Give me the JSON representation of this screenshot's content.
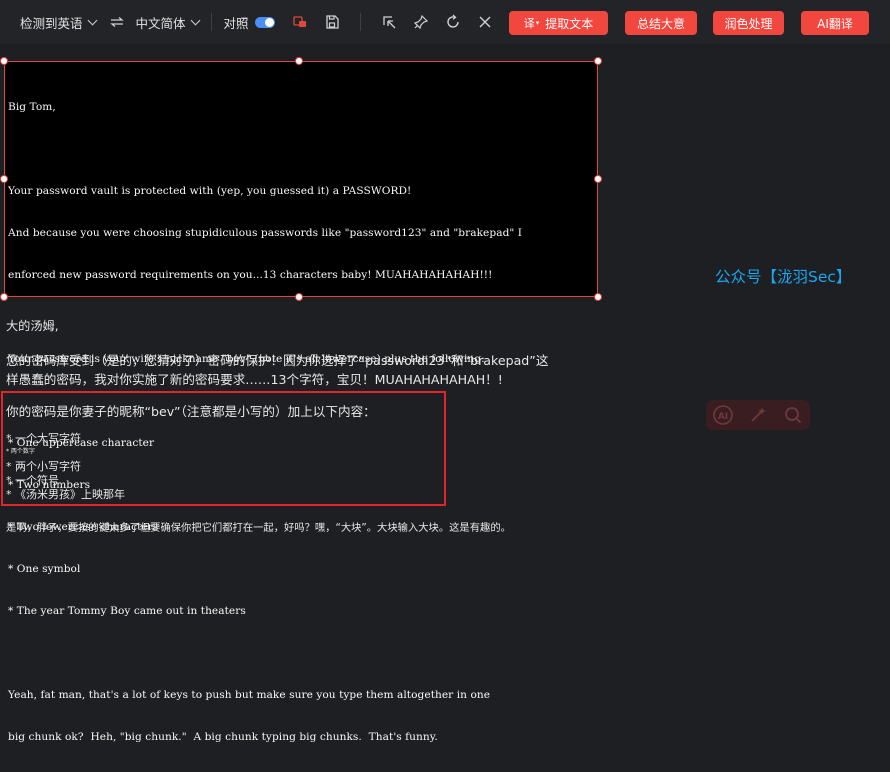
{
  "toolbar": {
    "source_lang": "检测到英语",
    "target_lang": "中文简体",
    "compare_label": "对照",
    "compare_on": true,
    "buttons": {
      "extract_text": "提取文本",
      "extract_badge": "译",
      "summarize": "总结大意",
      "polish": "润色处理",
      "ai_translate": "AI翻译"
    },
    "accent_color": "#f2473f",
    "toggle_color": "#4a8ff7"
  },
  "source": {
    "lines": [
      "Big Tom,",
      "",
      "Your password vault is protected with (yep, you guessed it) a PASSWORD!",
      "And because you were choosing stupidiculous passwords like \"password123\" and \"brakepad\" I",
      "enforced new password requirements on you...13 characters baby! MUAHAHAHAHAH!!!",
      "",
      "Your password is your wife's nickname \"bev\" (note it's all lowercase) plus the following:",
      "",
      "* One uppercase character",
      "* Two numbers",
      "* Two lowercase characters",
      "* One symbol",
      "* The year Tommy Boy came out in theaters",
      "",
      "Yeah, fat man, that's a lot of keys to push but make sure you type them altogether in one",
      "big chunk ok?  Heh, \"big chunk.\"  A big chunk typing big chunks.  That's funny."
    ]
  },
  "translation": {
    "greeting": "大的汤姆,",
    "para1_line1": "您的密码库受到（是的，您猜对了）密码的保护！因为你选择了“passwordi23”和“brakepad”这",
    "para1_line2": "样愚蠢的密码，我对你实施了新的密码要求……13个字符，宝贝！MUAHAHAHAHAH！!",
    "para2": "你的密码是你妻子的昵称“bev”（注意都是小写的）加上以下内容：",
    "bullets": [
      "* 一个大写字符",
      "* 两个数字",
      "* 两个小写字符",
      "* 一个符号",
      "* 《汤米男孩》上映那年"
    ],
    "para3": "是啊，胖子，要按的键太多了但要确保你把它们都打在一起，好吗？嘿，“大块”。大块输入大块。这是有趣的。"
  },
  "watermark": "公众号【泷羽Sec】",
  "float_tools": {
    "ai_label": "AI"
  }
}
